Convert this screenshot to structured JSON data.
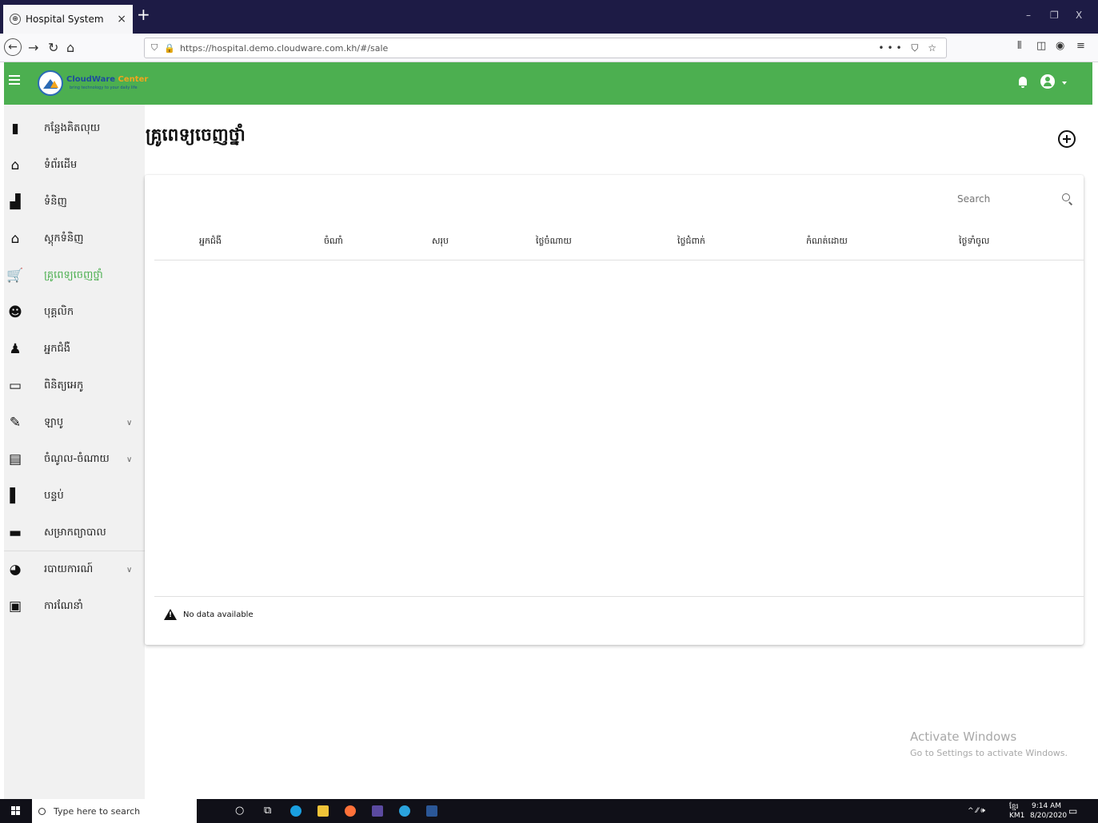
{
  "browser": {
    "tab_title": "Hospital System",
    "tab_close": "×",
    "new_tab": "+",
    "url": "https://hospital.demo.cloudware.com.kh/#/sale",
    "url_actions": "••• ⛉ ☆",
    "win_min": "–",
    "win_max": "❐",
    "win_close": "X"
  },
  "header": {
    "brand_main": "CloudWare",
    "brand_accent": " Center",
    "brand_tagline": "bring technology to your daily life"
  },
  "sidebar": {
    "items": [
      {
        "label": "កន្លែងគិតលុយ",
        "icon": "cashier-icon"
      },
      {
        "label": "ទំព័រដើម",
        "icon": "home-icon"
      },
      {
        "label": "ទំនិញ",
        "icon": "products-icon"
      },
      {
        "label": "ស្តុកទំនិញ",
        "icon": "warehouse-icon"
      },
      {
        "label": "គ្រូពេទ្យចេញថ្នាំ",
        "icon": "cart-icon"
      },
      {
        "label": "បុគ្គលិក",
        "icon": "staff-icon"
      },
      {
        "label": "អ្នកជំងឺ",
        "icon": "patient-icon"
      },
      {
        "label": "ពិនិត្យអេកូ",
        "icon": "monitor-icon"
      },
      {
        "label": "ឡាបូ",
        "icon": "lab-icon"
      },
      {
        "label": "ចំណូល-ចំណាយ",
        "icon": "finance-icon"
      },
      {
        "label": "បន្ទប់",
        "icon": "room-icon"
      },
      {
        "label": "សម្រាកព្យាបាល",
        "icon": "bed-icon"
      },
      {
        "label": "របាយការណ៍",
        "icon": "report-icon"
      },
      {
        "label": "ការណែនាំ",
        "icon": "guide-icon"
      }
    ]
  },
  "main": {
    "title": "គ្រូពេទ្យចេញថ្នាំ",
    "search_placeholder": "Search",
    "columns": [
      "អ្នកជំងឺ",
      "ចំណាំ",
      "សរុប",
      "ថ្លៃចំណាយ",
      "ថ្លៃជំពាក់",
      "កំណត់ដោយ",
      "ថ្ងៃទាំចូល"
    ],
    "no_data": "No data available"
  },
  "watermark": {
    "title": "Activate Windows",
    "subtitle": "Go to Settings to activate Windows."
  },
  "taskbar": {
    "search_placeholder": "Type here to search",
    "lang": "ខ្មែរ",
    "lang_sub": "KM1",
    "time": "9:14 AM",
    "date": "8/20/2020",
    "tray_icons": "^ ⁄⁄ 🕪"
  },
  "colors": {
    "header_green": "#4caf50",
    "active_green": "#4caf50",
    "tabbar_dark": "#1d1b45"
  }
}
